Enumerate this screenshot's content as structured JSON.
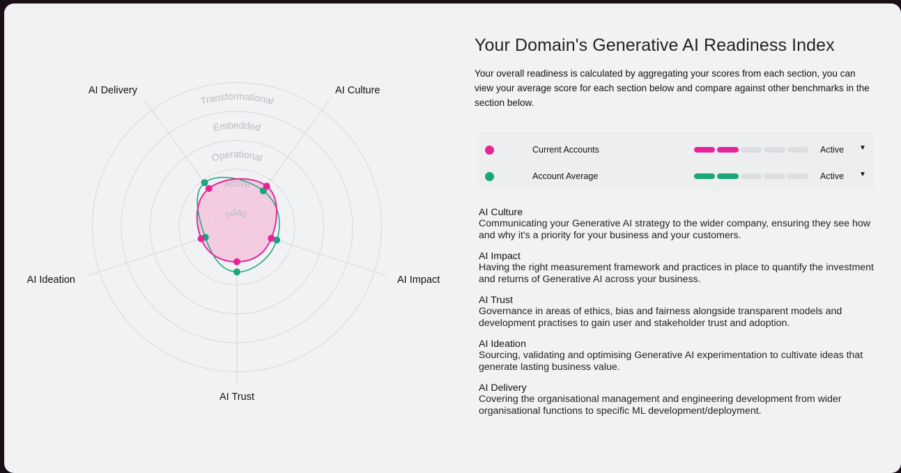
{
  "title": "Your Domain's Generative AI Readiness Index",
  "intro": "Your overall readiness is calculated by aggregating your scores from each section, you can view your average score for each section below and compare against other benchmarks in the section below.",
  "colors": {
    "current": "#e6249a",
    "average": "#1aa57a",
    "fill": "#f3c6de",
    "ring": "#d6d7da",
    "ringLabel": "#b9bcc2"
  },
  "chart_data": {
    "type": "radar",
    "axes": [
      "AI Culture",
      "AI Impact",
      "AI Trust",
      "AI Ideation",
      "AI Delivery"
    ],
    "levels": [
      "Foundational",
      "Active",
      "Operational",
      "Embedded",
      "Transformational"
    ],
    "scale_max": 5,
    "series": [
      {
        "name": "Current Accounts",
        "values": [
          1.75,
          1.25,
          1.2,
          1.3,
          1.65
        ]
      },
      {
        "name": "Account Average",
        "values": [
          1.55,
          1.45,
          1.55,
          1.15,
          1.9
        ]
      }
    ]
  },
  "legend": [
    {
      "name": "Current Accounts",
      "level": "Active",
      "filled": 2,
      "total": 5,
      "color": "#e6249a"
    },
    {
      "name": "Account Average",
      "level": "Active",
      "filled": 2,
      "total": 5,
      "color": "#1aa57a"
    }
  ],
  "sections": [
    {
      "title": "AI Culture",
      "text": "Communicating your Generative AI strategy to the wider company, ensuring they see how and why it's a priority for your business and your customers."
    },
    {
      "title": "AI Impact",
      "text": "Having the right measurement framework and practices in place to quantify the investment and returns of Generative AI across your business."
    },
    {
      "title": "AI Trust",
      "text": "Governance in areas of ethics, bias and fairness alongside transparent models and development practises to gain user and stakeholder trust and adoption."
    },
    {
      "title": "AI Ideation",
      "text": "Sourcing, validating and optimising Generative AI experimentation to cultivate ideas that generate lasting business value."
    },
    {
      "title": "AI Delivery",
      "text": "Covering the organisational management and engineering development from wider organisational functions to specific ML development/deployment."
    }
  ]
}
